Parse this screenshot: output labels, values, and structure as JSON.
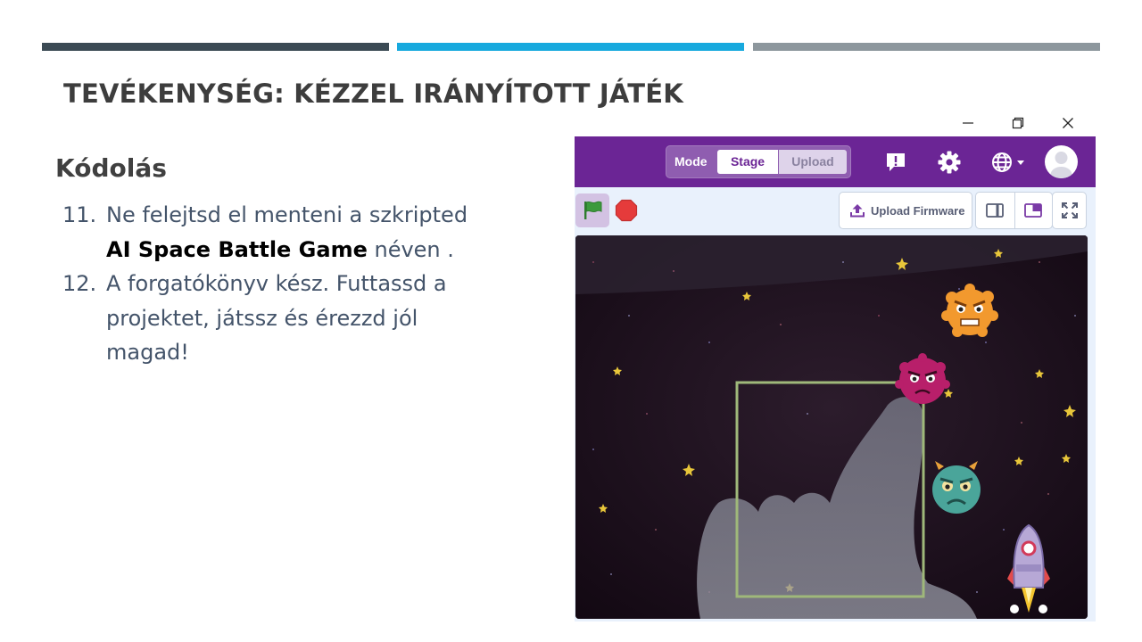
{
  "slide": {
    "title": "TEVÉKENYSÉG: KÉZZEL IRÁNYÍTOTT JÁTÉK",
    "section_heading": "Kódolás",
    "steps": [
      {
        "number": "11.",
        "text_before": "Ne felejtsd el menteni a szkripted ",
        "bold_text": "AI Space Battle Game",
        "text_after": " néven ."
      },
      {
        "number": "12.",
        "text": "A forgatókönyv kész. Futtassd a projektet, játssz és érezzd jól magad!"
      }
    ],
    "accent_colors": [
      "#3b4a54",
      "#17a9de",
      "#8d979d"
    ]
  },
  "window": {
    "controls": [
      "minimize-icon",
      "restore-icon",
      "close-icon"
    ]
  },
  "app": {
    "header": {
      "mode_label": "Mode",
      "mode_options": [
        "Stage",
        "Upload"
      ],
      "selected_mode": "Stage",
      "icons": [
        "feedback-icon",
        "gear-icon",
        "globe-icon",
        "avatar"
      ]
    },
    "toolbar": {
      "upload_firmware_label": "Upload Firmware",
      "icons": [
        "green-flag-icon",
        "stop-icon",
        "upload-icon",
        "small-stage-layout-icon",
        "large-stage-layout-icon",
        "fullscreen-icon"
      ]
    },
    "stage": {
      "sprites": [
        "orange-monster",
        "pink-monster",
        "green-monster",
        "rocket"
      ],
      "overlay": "camera feed of pointing hand with green rectangle"
    },
    "colors": {
      "brand_purple": "#6b2595",
      "flag_green": "#3c9a3c",
      "stop_red": "#e53b3b"
    }
  }
}
